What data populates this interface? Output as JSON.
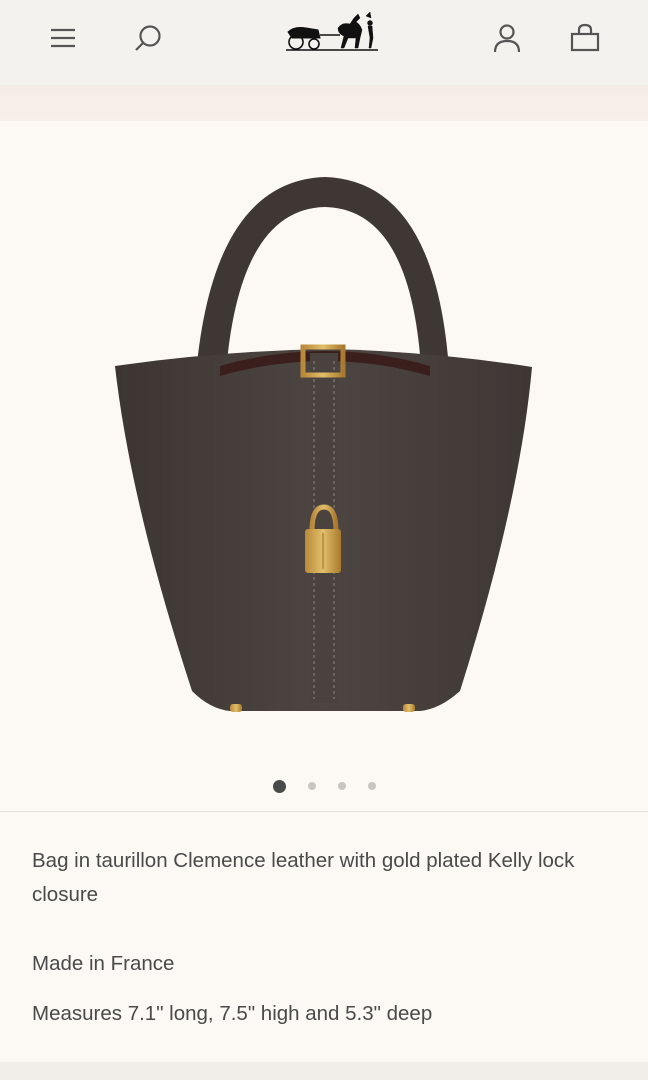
{
  "header": {
    "menu_icon": "hamburger-menu-icon",
    "search_icon": "search-icon",
    "logo": "hermes-carriage-logo",
    "account_icon": "user-icon",
    "bag_icon": "shopping-bag-icon"
  },
  "product": {
    "image": "picotin-bag-photo",
    "description": "Bag in taurillon Clemence leather with gold plated Kelly lock closure",
    "origin": "Made in France",
    "measures": "Measures 7.1\" long, 7.5\" high and 5.3\" deep",
    "leather_color": "#4a4340",
    "hardware_color": "#c9a24a"
  },
  "carousel": {
    "total": 4,
    "active_index": 1
  }
}
